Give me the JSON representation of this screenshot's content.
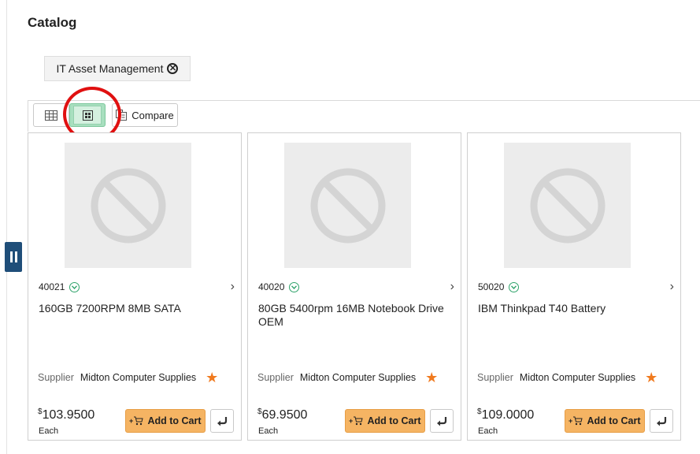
{
  "page": {
    "title": "Catalog"
  },
  "filter": {
    "label": "IT Asset Management"
  },
  "toolbar": {
    "compare_label": "Compare"
  },
  "cards": [
    {
      "id": "40021",
      "name": "160GB 7200RPM 8MB SATA",
      "supplier_label": "Supplier",
      "supplier": "Midton Computer Supplies",
      "currency": "$",
      "price": "103.9500",
      "unit": "Each",
      "add_label": "Add to Cart"
    },
    {
      "id": "40020",
      "name": "80GB 5400rpm 16MB Notebook Drive OEM",
      "supplier_label": "Supplier",
      "supplier": "Midton Computer Supplies",
      "currency": "$",
      "price": "69.9500",
      "unit": "Each",
      "add_label": "Add to Cart"
    },
    {
      "id": "50020",
      "name": "IBM Thinkpad T40 Battery",
      "supplier_label": "Supplier",
      "supplier": "Midton Computer Supplies",
      "currency": "$",
      "price": "109.0000",
      "unit": "Each",
      "add_label": "Add to Cart"
    }
  ],
  "colors": {
    "accent_green": "#a8dfbf",
    "cart_orange": "#f5b463",
    "star_orange": "#f07a1e",
    "highlight_red": "#e01010",
    "side_tab_navy": "#1f4e79"
  }
}
